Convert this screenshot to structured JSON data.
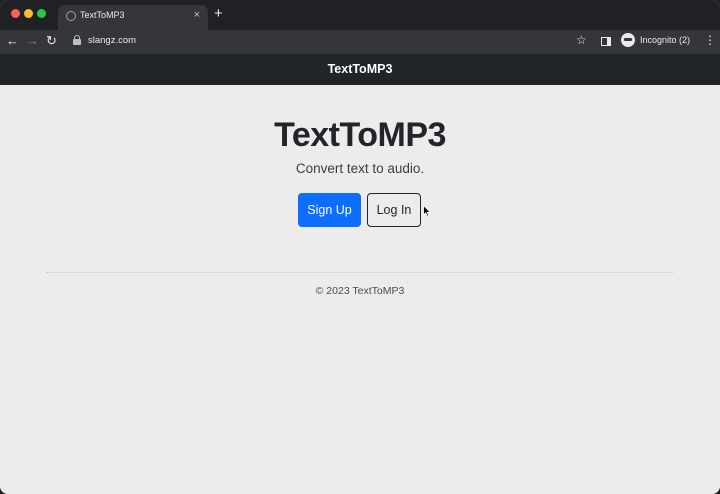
{
  "browser": {
    "tab_title": "TextToMP3",
    "tab_close": "×",
    "new_tab": "+",
    "back": "←",
    "forward": "→",
    "reload": "↻",
    "url": "slangz.com",
    "star": "☆",
    "incognito_label": "Incognito (2)",
    "menu": "⋮"
  },
  "navbar": {
    "brand": "TextToMP3"
  },
  "hero": {
    "title": "TextToMP3",
    "subtitle": "Convert text to audio.",
    "signup_label": "Sign Up",
    "login_label": "Log In"
  },
  "footer": {
    "text": "© 2023 TextToMP3"
  },
  "colors": {
    "primary": "#0d6efd",
    "navbar_bg": "#212529",
    "page_bg": "#ececec"
  }
}
